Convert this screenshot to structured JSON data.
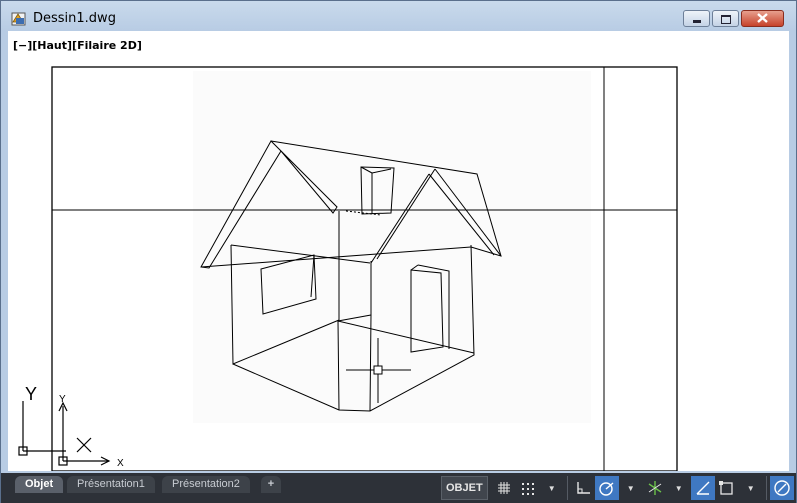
{
  "window": {
    "title": "Dessin1.dwg"
  },
  "viewport": {
    "label": "[−][Haut][Filaire 2D]"
  },
  "ucs": {
    "world_x": "X",
    "world_y": "Y",
    "small_x": "X",
    "small_y": "Y"
  },
  "tabs": [
    {
      "label": "Objet"
    },
    {
      "label": "Présentation1"
    },
    {
      "label": "Présentation2"
    },
    {
      "label": "+"
    }
  ],
  "status": {
    "model_label": "OBJET"
  },
  "icons": [
    "grid-icon",
    "snap-icon",
    "ortho-icon",
    "polar-icon",
    "osnap-icon",
    "dyn-ucs-icon",
    "selection-icon",
    "workspace-icon",
    "fullscreen-icon",
    "menu-icon"
  ],
  "colors": {
    "canvas": "#ffffff",
    "statusbar": "#2d3138",
    "accent": "#3f78c2"
  }
}
